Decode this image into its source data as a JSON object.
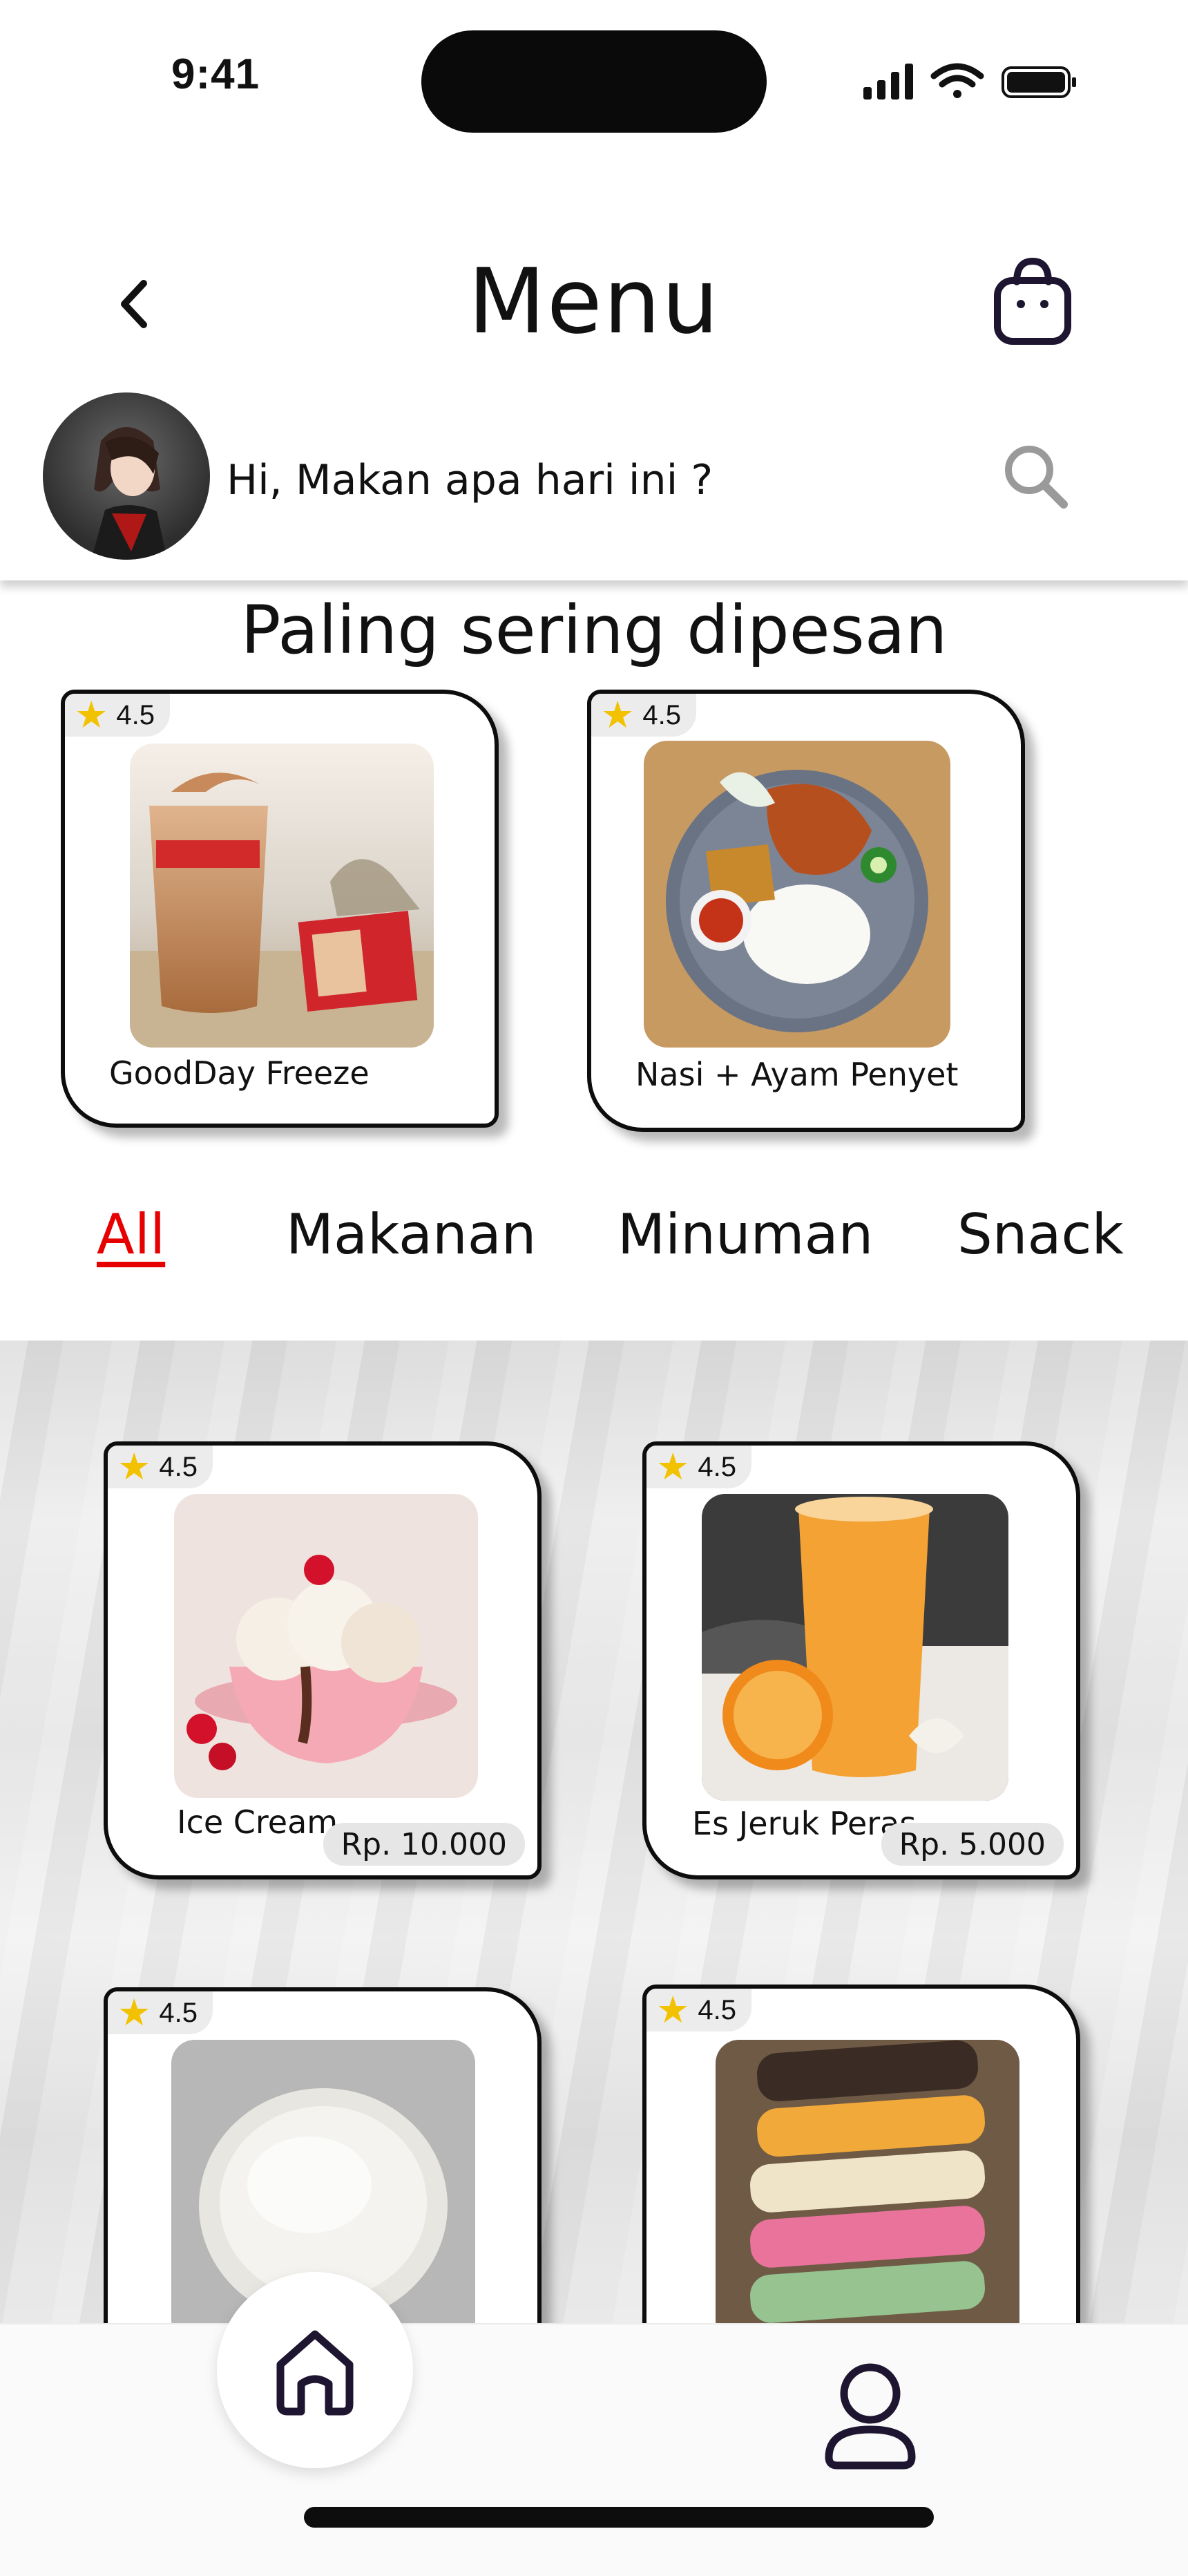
{
  "status_bar": {
    "time": "9:41"
  },
  "header": {
    "title": "Menu"
  },
  "greeting": {
    "text": "Hi, Makan apa hari ini ?"
  },
  "popular": {
    "title": "Paling sering dipesan",
    "items": [
      {
        "name": "GoodDay Freeze",
        "rating": "4.5"
      },
      {
        "name": "Nasi + Ayam Penyet",
        "rating": "4.5"
      }
    ]
  },
  "tabs": [
    {
      "label": "All",
      "active": true
    },
    {
      "label": "Makanan",
      "active": false
    },
    {
      "label": "Minuman",
      "active": false
    },
    {
      "label": "Snack",
      "active": false
    }
  ],
  "menu_items": [
    {
      "name": "Ice Cream",
      "rating": "4.5",
      "price": "Rp. 10.000"
    },
    {
      "name": "Es Jeruk Peras",
      "rating": "4.5",
      "price": "Rp. 5.000"
    },
    {
      "name": "",
      "rating": "4.5",
      "price": ""
    },
    {
      "name": "",
      "rating": "4.5",
      "price": ""
    }
  ],
  "colors": {
    "accent": "#e60000",
    "star": "#f2c200",
    "icon_dark": "#1e1530"
  },
  "icons": [
    "back-icon",
    "shopping-bag-icon",
    "search-icon",
    "star-icon",
    "home-icon",
    "profile-icon",
    "signal-icon",
    "wifi-icon",
    "battery-icon"
  ]
}
